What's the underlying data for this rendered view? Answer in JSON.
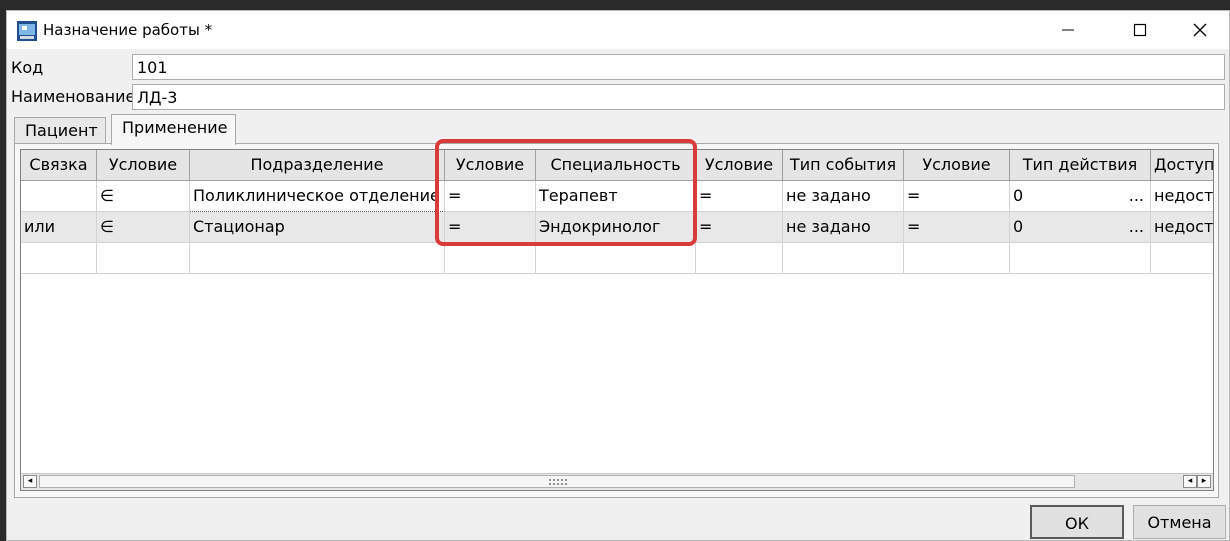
{
  "window": {
    "title": "Назначение работы *"
  },
  "form": {
    "code_label": "Код",
    "code_value": "101",
    "name_label": "Наименование",
    "name_value": "ЛД-3"
  },
  "tabs": [
    {
      "label": "Пациент",
      "active": false
    },
    {
      "label": "Применение",
      "active": true
    }
  ],
  "grid": {
    "columns": [
      "Связка",
      "Условие",
      "Подразделение",
      "Условие",
      "Специальность",
      "Условие",
      "Тип события",
      "Условие",
      "Тип действия",
      "Доступно"
    ],
    "rows": [
      [
        "",
        "∈",
        "Поликлиническое отделение ...",
        "=",
        "Терапевт",
        "=",
        "не задано",
        "=",
        "0",
        "недоступ"
      ],
      [
        "или",
        "∈",
        "Стационар",
        "=",
        "Эндокринолог",
        "=",
        "не задано",
        "=",
        "0",
        "недоступ"
      ]
    ],
    "ellipsis": "..."
  },
  "buttons": {
    "ok": "ОК",
    "cancel": "Отмена"
  },
  "colors": {
    "highlight": "#d93a3a"
  }
}
